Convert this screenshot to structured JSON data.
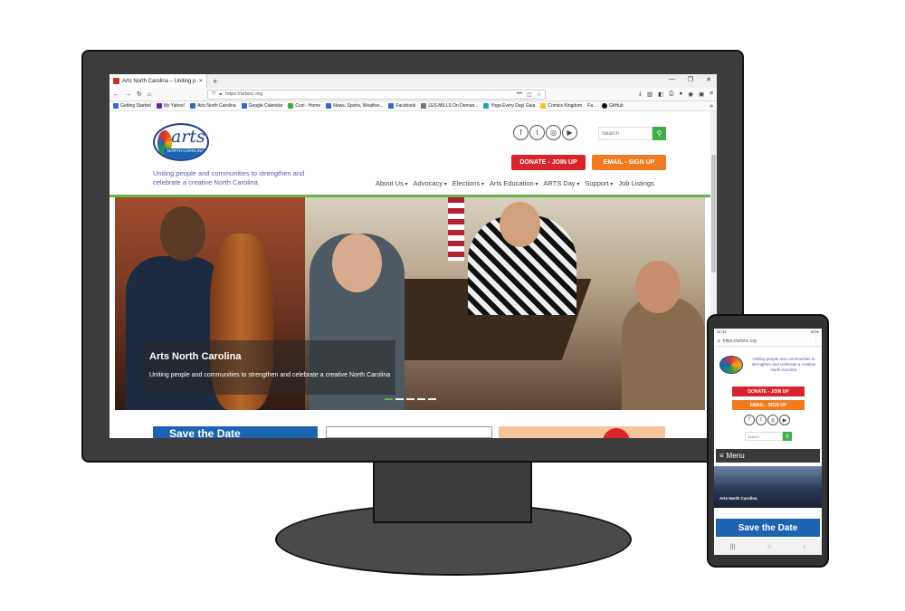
{
  "browser": {
    "tab_title": "Arts North Carolina – Uniting p",
    "tab_close": "✕",
    "new_tab": "+",
    "window_controls": [
      "—",
      "❐",
      "✕"
    ],
    "url": "https://artsnc.org",
    "url_actions": "•••",
    "bookmarks": [
      "Getting Started",
      "My Yahoo!",
      "Arts North Carolina",
      "Google Calendar",
      "Cozi - Home",
      "News, Sports, Weather...",
      "Facebook",
      "LES MILLS On Deman...",
      "Yoga Every Day| Gaia",
      "Comics Kingdom",
      "Fa...",
      "GitHub"
    ],
    "bookmarks_more": "»"
  },
  "site": {
    "logo_text": "arts",
    "logo_band": "NORTH CAROLINA",
    "tagline": "Uniting people and communities to strengthen and celebrate a creative North Carolina",
    "search_placeholder": "Search",
    "search_button_icon": "search-icon",
    "donate_label": "DONATE - JOIN UP",
    "email_label": "EMAIL - SIGN UP",
    "social": [
      {
        "icon": "facebook-icon",
        "glyph": "f"
      },
      {
        "icon": "twitter-icon",
        "glyph": "t"
      },
      {
        "icon": "instagram-icon",
        "glyph": "◎"
      },
      {
        "icon": "youtube-icon",
        "glyph": "▶"
      }
    ],
    "nav": [
      "About Us",
      "Advocacy",
      "Elections",
      "Arts Education",
      "ARTS Day",
      "Support",
      "Job Listings"
    ],
    "hero": {
      "title": "Arts North Carolina",
      "subtitle": "Uniting people and communities to strengthen and celebrate a creative North Carolina",
      "slide_count": 5,
      "active_slide": 1
    },
    "card1_text": "Save the Date",
    "colors": {
      "accent_green": "#6ab04c",
      "donate_red": "#d8242b",
      "email_orange": "#f07a1f",
      "brand_blue": "#1d64b0"
    }
  },
  "phone": {
    "status_left": "11:11",
    "status_right": "84%",
    "url": "https://artsnc.org",
    "tagline": "Uniting people and communities to strengthen and celebrate a creative North Carolina",
    "donate_label": "DONATE - JOIN UP",
    "email_label": "EMAIL - SIGN UP",
    "search_placeholder": "Search",
    "menu_label": "Menu",
    "hero_caption": "Arts North Carolina",
    "save_label": "Save the Date",
    "nav_buttons": [
      "|||",
      "○",
      "‹"
    ]
  }
}
